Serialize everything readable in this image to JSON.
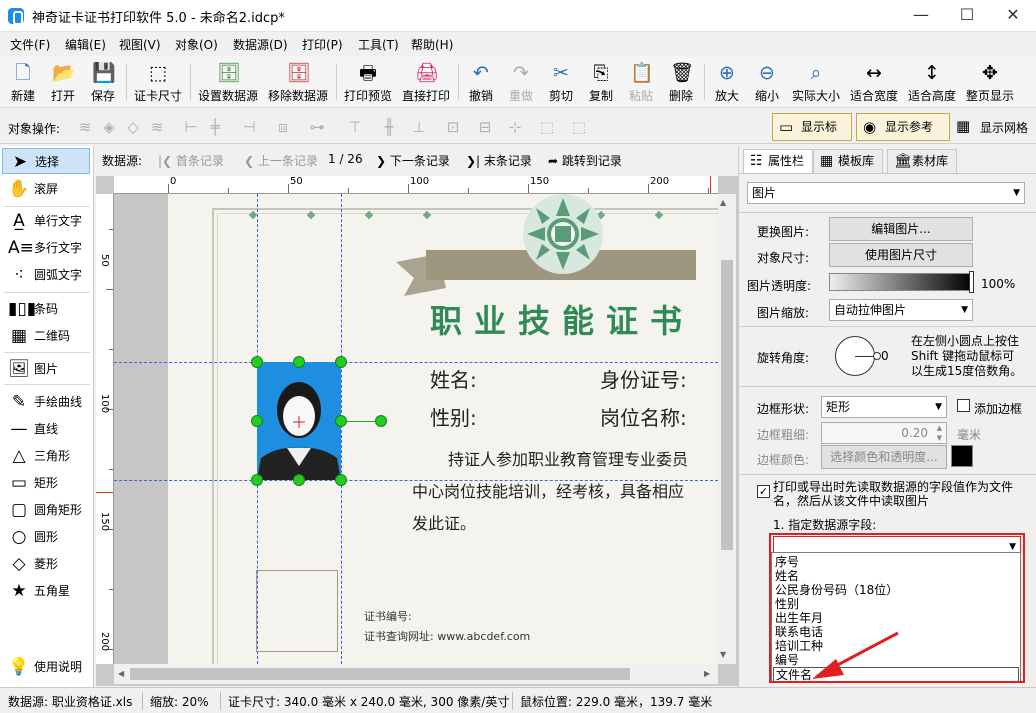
{
  "window": {
    "title": "神奇证卡证书打印软件 5.0 - 未命名2.idcp*",
    "controls": [
      "—",
      "☐",
      "✕"
    ]
  },
  "menu": [
    "文件(F)",
    "编辑(E)",
    "视图(V)",
    "对象(O)",
    "数据源(D)",
    "打印(P)",
    "工具(T)",
    "帮助(H)"
  ],
  "toolbar": [
    {
      "label": "新建",
      "icon": "new-file-icon",
      "glyph": "🗋"
    },
    {
      "label": "打开",
      "icon": "open-icon",
      "glyph": "📂"
    },
    {
      "label": "保存",
      "icon": "save-icon",
      "glyph": "💾"
    },
    {
      "label": "证卡尺寸",
      "icon": "card-size-icon",
      "glyph": "⬚"
    },
    {
      "label": "设置数据源",
      "icon": "datasource-icon",
      "glyph": "🗄"
    },
    {
      "label": "移除数据源",
      "icon": "remove-datasource-icon",
      "glyph": "🗄"
    },
    {
      "label": "打印预览",
      "icon": "print-preview-icon",
      "glyph": "🖶"
    },
    {
      "label": "直接打印",
      "icon": "print-icon",
      "glyph": "🖨"
    },
    {
      "label": "撤销",
      "icon": "undo-icon",
      "glyph": "↶"
    },
    {
      "label": "重做",
      "icon": "redo-icon",
      "glyph": "↷"
    },
    {
      "label": "剪切",
      "icon": "cut-icon",
      "glyph": "✂"
    },
    {
      "label": "复制",
      "icon": "copy-icon",
      "glyph": "⎘"
    },
    {
      "label": "粘贴",
      "icon": "paste-icon",
      "glyph": "📋"
    },
    {
      "label": "删除",
      "icon": "delete-icon",
      "glyph": "🗑"
    },
    {
      "label": "放大",
      "icon": "zoom-in-icon",
      "glyph": "⊕"
    },
    {
      "label": "缩小",
      "icon": "zoom-out-icon",
      "glyph": "⊖"
    },
    {
      "label": "实际大小",
      "icon": "actual-size-icon",
      "glyph": "⌕"
    },
    {
      "label": "适合宽度",
      "icon": "fit-width-icon",
      "glyph": "↔"
    },
    {
      "label": "适合高度",
      "icon": "fit-height-icon",
      "glyph": "↕"
    },
    {
      "label": "整页显示",
      "icon": "fit-page-icon",
      "glyph": "✥"
    }
  ],
  "ops": {
    "label": "对象操作:",
    "show_ruler": "显示标尺",
    "show_guides": "显示参考线",
    "show_grid": "显示网格"
  },
  "tools": [
    "选择",
    "滚屏",
    "单行文字",
    "多行文字",
    "圆弧文字",
    "条码",
    "二维码",
    "图片",
    "手绘曲线",
    "直线",
    "三角形",
    "矩形",
    "圆角矩形",
    "圆形",
    "菱形",
    "五角星",
    "使用说明"
  ],
  "nav": {
    "label": "数据源:",
    "first": "首条记录",
    "prev": "上一条记录",
    "counter": "1 / 26",
    "next": "下一条记录",
    "last": "末条记录",
    "jump": "跳转到记录"
  },
  "rulers": {
    "h_ticks": [
      "0",
      "50",
      "100",
      "150",
      "200"
    ],
    "v_ticks": [
      "50",
      "100",
      "150",
      "200"
    ]
  },
  "certificate": {
    "title": "职业技能证书",
    "name_label": "姓名:",
    "id_label": "身份证号:",
    "gender_label": "性别:",
    "position_label": "岗位名称:",
    "body_line1": "持证人参加职业教育管理专业委员",
    "body_line2": "中心岗位技能培训，经考核，具备相应",
    "body_line3": "发此证。",
    "cert_no_label": "证书编号:",
    "query_url": "证书查询网址: www.abcdef.com"
  },
  "panel": {
    "tabs": [
      "属性栏",
      "模板库",
      "素材库"
    ],
    "object_type": "图片",
    "replace_label": "更换图片:",
    "edit_btn": "编辑图片...",
    "size_label": "对象尺寸:",
    "use_size_btn": "使用图片尺寸",
    "opacity_label": "图片透明度:",
    "opacity_value": "100%",
    "opacity": 1.0,
    "scale_label": "图片缩放:",
    "scale_value": "自动拉伸图片",
    "rotate_label": "旋转角度:",
    "rotate_value": "0",
    "rotate_hint1": "在左侧小圆点上按住",
    "rotate_hint2": "Shift 键拖动鼠标可",
    "rotate_hint3": "以生成15度倍数角。",
    "border_shape_label": "边框形状:",
    "border_shape": "矩形",
    "add_border": "添加边框",
    "border_width_label": "边框粗细:",
    "border_width": "0.20",
    "border_unit": "毫米",
    "border_color_label": "边框颜色:",
    "border_color_btn": "选择颜色和透明度...",
    "datasource_check1": "打印或导出时先读取数据源的字段值作为文件",
    "datasource_check2": "名，然后从该文件中读取图片",
    "field_label": "1. 指定数据源字段:",
    "field_options": [
      "序号",
      "姓名",
      "公民身份号码（18位）",
      "性别",
      "出生年月",
      "联系电话",
      "培训工种",
      "编号",
      "文件名"
    ],
    "highlight_color": "#e02020"
  },
  "status": {
    "datasource": "数据源: 职业资格证.xls",
    "zoom": "缩放: 20%",
    "card_size": "证卡尺寸: 340.0 毫米 x 240.0 毫米, 300 像素/英寸",
    "mouse": "鼠标位置: 229.0 毫米，139.7 毫米"
  },
  "colors": {
    "accent_green": "#2f8a55",
    "handle_green": "#22cc22",
    "toggle_bg": "#fbf3d9"
  }
}
